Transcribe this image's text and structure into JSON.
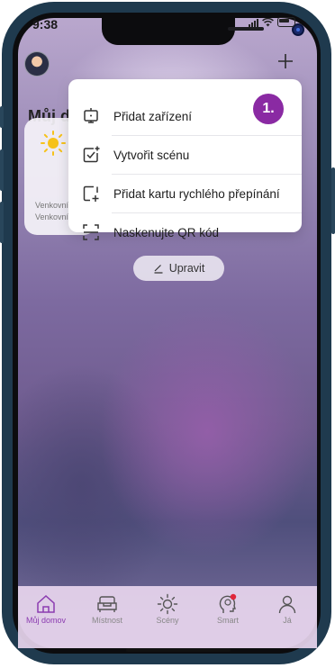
{
  "status_bar": {
    "time": "9:38"
  },
  "header": {
    "title": "Můj domov"
  },
  "weather_card": {
    "line1": "Venkovní",
    "line2": "Venkovní"
  },
  "add_menu": {
    "items": [
      {
        "label": "Přidat zařízení",
        "icon": "device-icon"
      },
      {
        "label": "Vytvořit scénu",
        "icon": "scene-add-icon"
      },
      {
        "label": "Přidat kartu rychlého přepínání",
        "icon": "card-add-icon"
      },
      {
        "label": "Naskenujte QR kód",
        "icon": "qr-scan-icon"
      }
    ]
  },
  "step_badge": "1.",
  "edit_button": {
    "label": "Upravit"
  },
  "tabbar": {
    "tabs": [
      {
        "label": "Můj domov",
        "icon": "home-icon",
        "active": true
      },
      {
        "label": "Místnost",
        "icon": "sofa-icon",
        "active": false
      },
      {
        "label": "Scény",
        "icon": "sun-icon",
        "active": false
      },
      {
        "label": "Smart",
        "icon": "brain-icon",
        "active": false
      },
      {
        "label": "Já",
        "icon": "person-icon",
        "active": false
      }
    ]
  },
  "colors": {
    "accent": "#8b3bb0",
    "badge": "#8a2aa3",
    "phone_frame": "#1f3a4e"
  }
}
